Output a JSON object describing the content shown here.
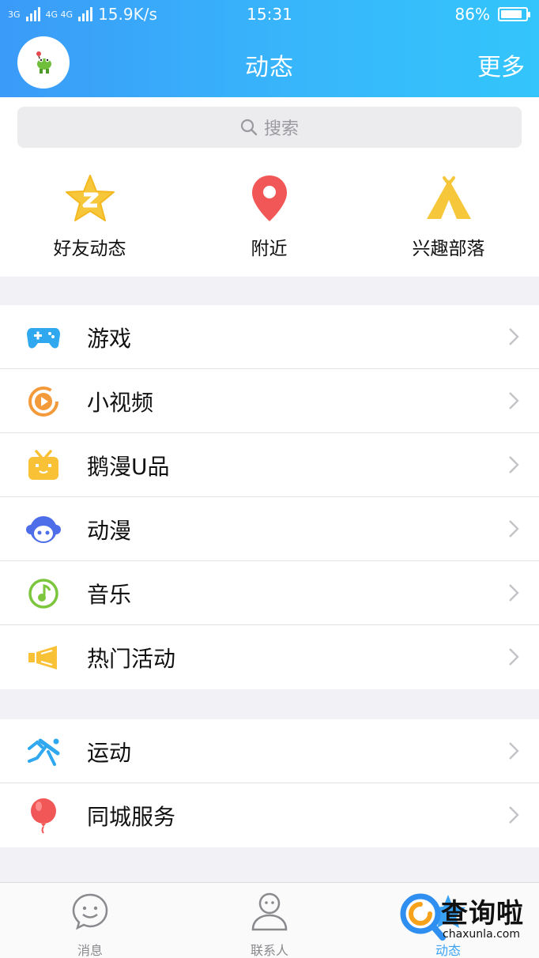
{
  "status_bar": {
    "signal_left": "3G",
    "signal_right": "4G 4G",
    "net_speed": "15.9K/s",
    "time": "15:31",
    "battery": "86%",
    "battery_level": 0.86
  },
  "header": {
    "title": "动态",
    "more_label": "更多",
    "avatar_icon": "frog-avatar-icon"
  },
  "search": {
    "placeholder": "搜索"
  },
  "quick_access": [
    {
      "label": "好友动态",
      "icon": "qzone-star-icon",
      "color": "#f7c73b"
    },
    {
      "label": "附近",
      "icon": "location-pin-icon",
      "color": "#f25757"
    },
    {
      "label": "兴趣部落",
      "icon": "tent-icon",
      "color": "#f7c73b"
    }
  ],
  "list_group_1": [
    {
      "label": "游戏",
      "icon": "gamepad-icon",
      "color": "#2fa8f0"
    },
    {
      "label": "小视频",
      "icon": "play-circle-icon",
      "color": "#f39a3a"
    },
    {
      "label": "鹅漫U品",
      "icon": "tv-box-icon",
      "color": "#f8c136"
    },
    {
      "label": "动漫",
      "icon": "anime-face-icon",
      "color": "#4d6ee8"
    },
    {
      "label": "音乐",
      "icon": "music-note-icon",
      "color": "#7cc63d"
    },
    {
      "label": "热门活动",
      "icon": "megaphone-icon",
      "color": "#f8c136"
    }
  ],
  "list_group_2": [
    {
      "label": "运动",
      "icon": "runner-icon",
      "color": "#2fa8f0"
    },
    {
      "label": "同城服务",
      "icon": "balloon-icon",
      "color": "#f25757"
    }
  ],
  "tab_bar": {
    "tabs": [
      {
        "label": "消息",
        "icon": "smiley-chat-icon"
      },
      {
        "label": "联系人",
        "icon": "person-icon"
      },
      {
        "label": "动态",
        "icon": "star-icon",
        "active": true
      }
    ]
  },
  "watermark": {
    "brand": "查询啦",
    "url": "chaxunla.com"
  },
  "colors": {
    "header_start": "#3a9bf8",
    "header_end": "#33c5fb",
    "accent": "#3aa2f5"
  }
}
